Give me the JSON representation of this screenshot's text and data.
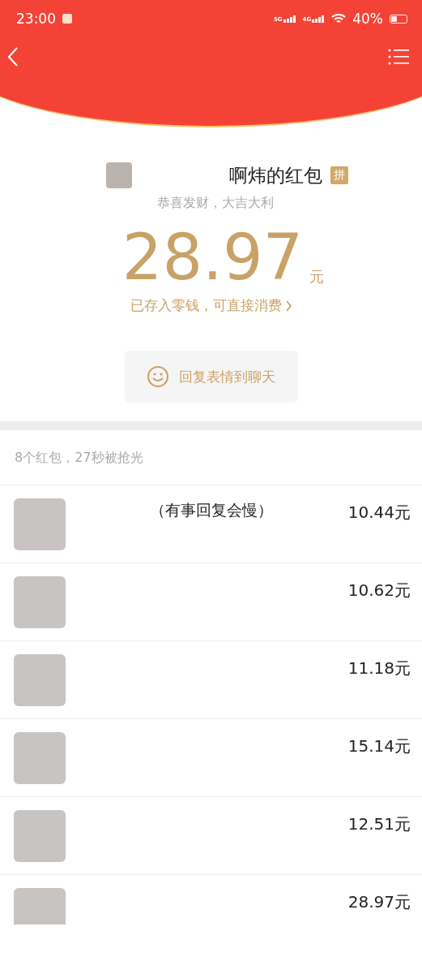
{
  "status_bar": {
    "time": "23:00",
    "network_1": "5G",
    "network_2": "4G",
    "battery": "40%"
  },
  "packet": {
    "title": "啊炜的红包",
    "tag": "拼",
    "blessing": "恭喜发财，大吉大利",
    "amount": "28.97",
    "unit": "元",
    "note": "已存入零钱，可直接消费",
    "reply_button": "回复表情到聊天"
  },
  "summary": "8个红包，27秒被抢光",
  "rows": [
    {
      "name": "（有事回复会慢）",
      "amount": "10.44元"
    },
    {
      "amount": "10.62元"
    },
    {
      "amount": "11.18元"
    },
    {
      "amount": "15.14元"
    },
    {
      "amount": "12.51元"
    },
    {
      "amount": "28.97元"
    }
  ]
}
